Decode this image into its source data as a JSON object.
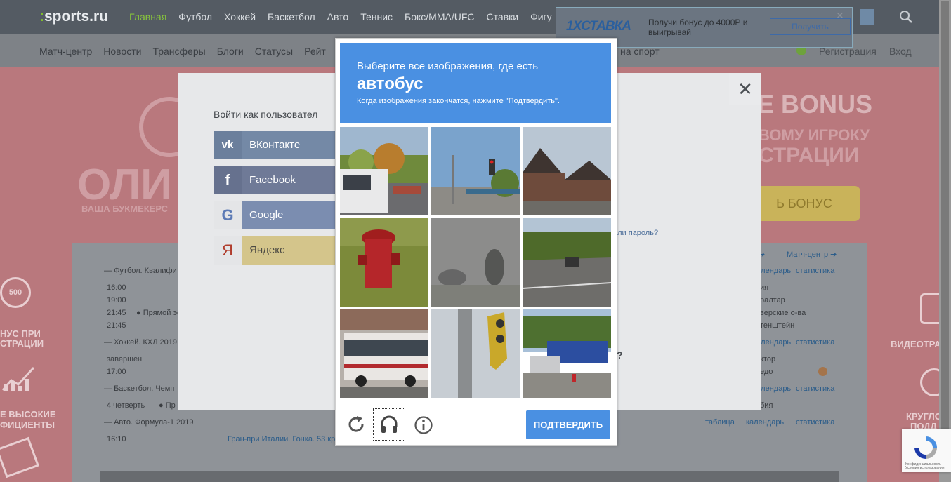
{
  "site": {
    "logo": "sports.ru",
    "main_nav": [
      "Главная",
      "Футбол",
      "Хоккей",
      "Баскетбол",
      "Авто",
      "Теннис",
      "Бокс/MMA/UFC",
      "Ставки",
      "Фигу"
    ],
    "sub_nav": [
      "Матч-центр",
      "Новости",
      "Трансферы",
      "Блоги",
      "Статусы",
      "Рейт"
    ],
    "sub_nav_tail": "на спорт",
    "register": "Регистрация",
    "login": "Вход"
  },
  "ad": {
    "brand": "1XСТАВКА",
    "text": "Получи бонус до 4000Р и выигрывай",
    "button": "Получить"
  },
  "background": {
    "left_big": "ОЛИ",
    "left_sub": "ВАША БУКМЕКЕРС",
    "right_big": "E BONUS",
    "right_line1": "ВОМУ ИГРОКУ",
    "right_line2": "СТРАЦИИ",
    "right_button": "Ь БОНУС",
    "promo_left": [
      "НУС ПРИ",
      "СТРАЦИИ",
      "Е ВЫСОКИЕ",
      "ФИЦИЕНТЫ"
    ],
    "promo_right": [
      "ВИДЕОТРА",
      "КРУГЛОС",
      "ПОДД"
    ],
    "badge_500": "500",
    "matches": [
      {
        "label": "Футбол. Квалифи",
        "times": [
          "16:00",
          "19:00",
          "21:45",
          "21:45"
        ],
        "live": "Прямой эф"
      },
      {
        "label": "Хоккей. КХЛ 2019",
        "status": "завершен",
        "time": "17:00"
      },
      {
        "label": "Баскетбол. Чемп",
        "status": "4 четверть",
        "live": "Пр"
      },
      {
        "label": "Авто. Формула-1 2019",
        "time": "16:10",
        "event": "Гран-при Италии. Гонка. 53 кр"
      }
    ],
    "right_links": [
      "Матч-центр",
      "календарь",
      "статистика",
      "таблица"
    ],
    "right_items": [
      "ия",
      "ралтар",
      "верские о-ва",
      "тенштейн",
      "ктор",
      "едо",
      "бия"
    ]
  },
  "login_dialog": {
    "title": "Войти как пользовател",
    "providers": [
      "ВКонтакте",
      "Facebook",
      "Google",
      "Яндекс"
    ],
    "forgot": "али пароль?",
    "question_mark": "?"
  },
  "captcha": {
    "line1": "Выберите все изображения, где есть",
    "keyword": "автобус",
    "line3": "Когда изображения закончатся, нажмите \"Подтвердить\".",
    "verify": "ПОДТВЕРДИТЬ",
    "icons": [
      "reload-icon",
      "headphones-icon",
      "info-icon"
    ],
    "tiles": [
      "white-bus-street",
      "traffic-light-corner",
      "brick-houses",
      "red-hydrant",
      "foggy-trees",
      "road-intersection",
      "city-bus",
      "traffic-light-closeup",
      "blue-bus-parking"
    ],
    "badge": "Конфиденциальность - Условия использования"
  },
  "colors": {
    "captcha_blue": "#4a90e2",
    "overlay_dark": "#545b63"
  }
}
